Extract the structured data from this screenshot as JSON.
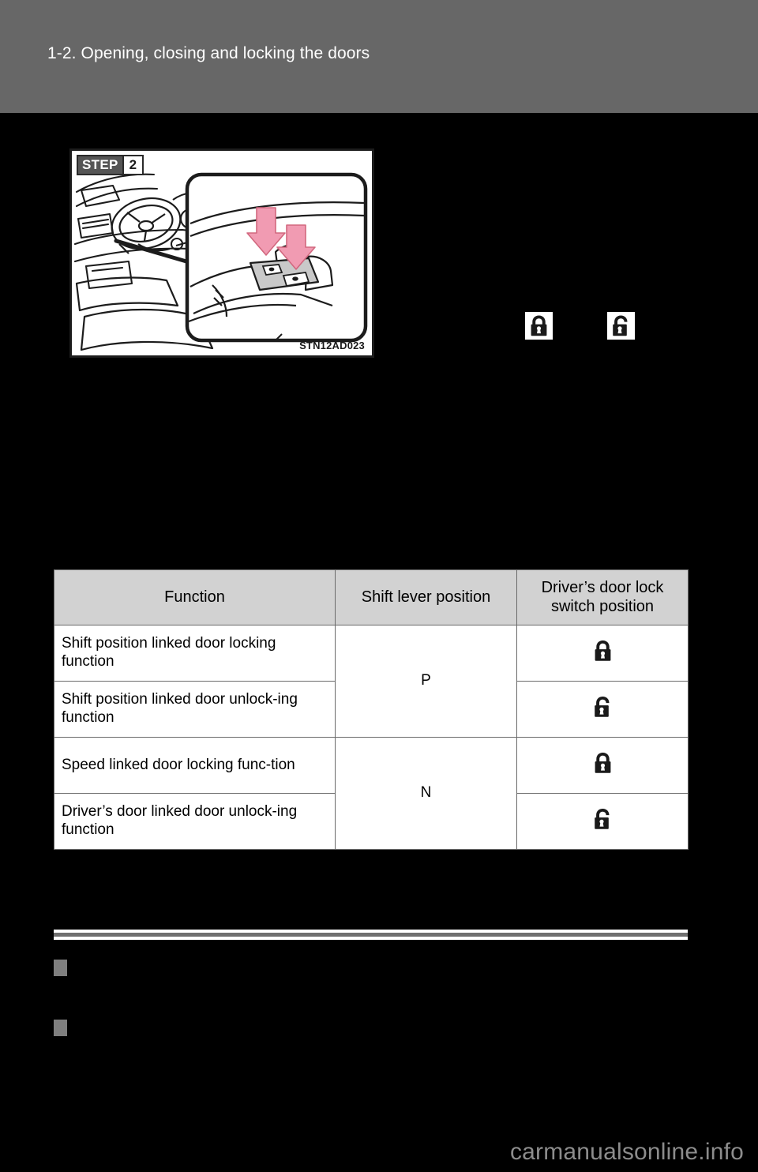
{
  "header": {
    "section_title": "1-2. Opening, closing and locking the doors"
  },
  "figure": {
    "step_word": "STEP",
    "step_number": "2",
    "image_code": "STN12AD023",
    "alt_description": "Vehicle interior view with close-up callout of the driver's door lock switch, pink arrows pointing down at the lock and unlock buttons"
  },
  "icon_legend": [
    {
      "name": "lock-icon",
      "state": "locked"
    },
    {
      "name": "unlock-icon",
      "state": "unlocked"
    }
  ],
  "table": {
    "headers": [
      "Function",
      "Shift lever position",
      "Driver’s door lock switch position"
    ],
    "rows": [
      {
        "function": "Shift position linked door locking function",
        "shift": "P",
        "shift_rowspan": 2,
        "switch_icon": "lock-icon"
      },
      {
        "function": "Shift position linked door unlock-ing function",
        "shift": "",
        "shift_rowspan": 0,
        "switch_icon": "unlock-icon"
      },
      {
        "function": "Speed linked door locking func-tion",
        "shift": "N",
        "shift_rowspan": 2,
        "switch_icon": "lock-icon"
      },
      {
        "function": "Driver’s door linked door unlock-ing function",
        "shift": "",
        "shift_rowspan": 0,
        "switch_icon": "unlock-icon"
      }
    ]
  },
  "sections": [
    {
      "heading": ""
    },
    {
      "heading": ""
    }
  ],
  "footer": {
    "watermark": "carmanualsonline.info"
  },
  "colors": {
    "header_band": "#676767",
    "page_background": "#000000",
    "table_header_fill": "#d2d2d2",
    "bullet": "#7f7f7f",
    "arrow_pink": "#f49ab0",
    "watermark": "#8c8c8c"
  }
}
